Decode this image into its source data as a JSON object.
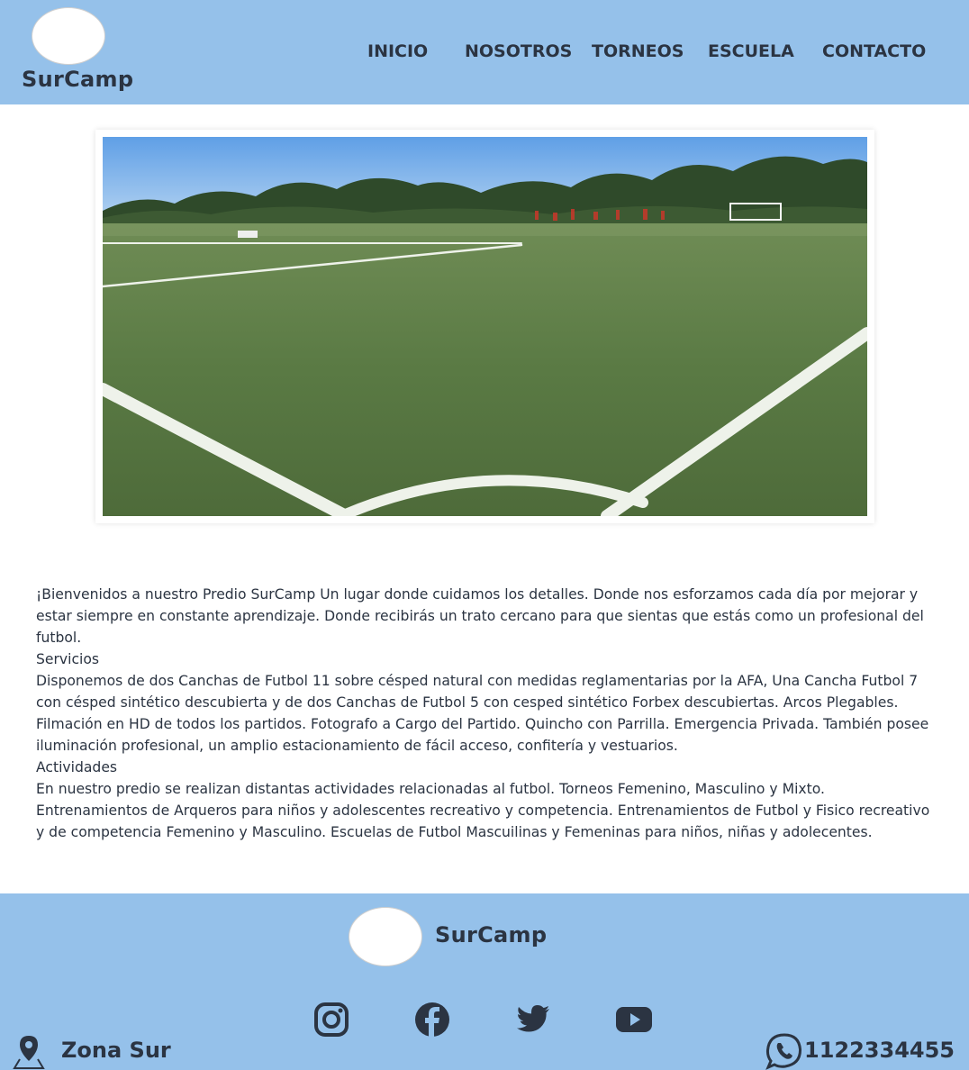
{
  "brand": {
    "name": "SurCamp"
  },
  "nav": {
    "items": [
      {
        "label": "INICIO"
      },
      {
        "label": "NOSOTROS"
      },
      {
        "label": "TORNEOS"
      },
      {
        "label": "ESCUELA"
      },
      {
        "label": "CONTACTO"
      }
    ]
  },
  "hero": {
    "image": "soccer-field-photo"
  },
  "content": {
    "welcome": "¡Bienvenidos a nuestro Predio SurCamp Un lugar donde cuidamos los detalles. Donde nos esforzamos cada día por mejorar y estar siempre en constante aprendizaje. Donde recibirás un trato cercano para que sientas que estás como un profesional del futbol.",
    "services_heading": "Servicios",
    "services_text": "Disponemos de dos Canchas de Futbol 11 sobre césped natural con medidas reglamentarias por la AFA, Una Cancha Futbol 7 con césped sintético descubierta y de dos Canchas de Futbol 5 con cesped sintético Forbex descubiertas. Arcos Plegables. Filmación en HD de todos los partidos. Fotografo a Cargo del Partido. Quincho con Parrilla. Emergencia Privada. También posee iluminación profesional, un amplio estacionamiento de fácil acceso, confitería y vestuarios.",
    "activities_heading": "Actividades",
    "activities_text": "En nuestro predio se realizan distantas actividades relacionadas al futbol. Torneos Femenino, Masculino y Mixto. Entrenamientos de Arqueros para niños y adolescentes recreativo y competencia. Entrenamientos de Futbol y Fisico recreativo y de competencia Femenino y Masculino. Escuelas de Futbol Mascuilinas y Femeninas para niños, niñas y adolecentes."
  },
  "footer": {
    "brand": "SurCamp",
    "social": [
      "instagram-icon",
      "facebook-icon",
      "twitter-icon",
      "youtube-icon"
    ],
    "location_icon": "map-pin-icon",
    "location": "Zona Sur",
    "phone_icon": "whatsapp-icon",
    "phone": "1122334455"
  },
  "colors": {
    "header_bg": "#95c1ea",
    "footer_bg": "#95c1ea",
    "text": "#2b3442",
    "background": "#ffffff"
  }
}
